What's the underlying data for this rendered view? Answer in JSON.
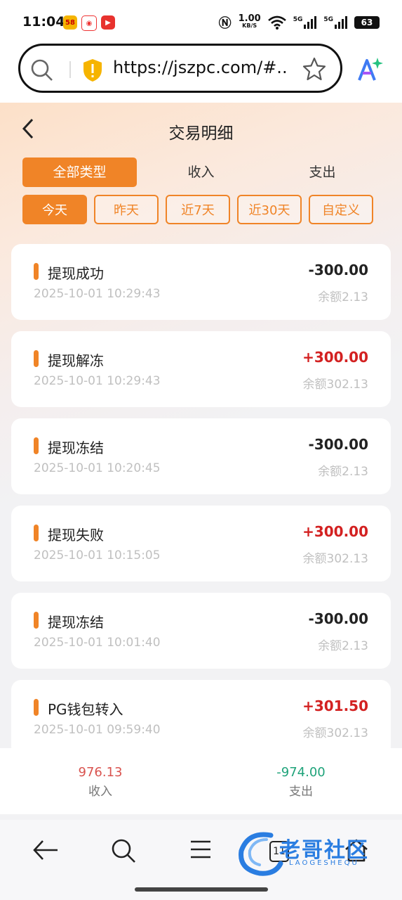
{
  "status": {
    "time": "11:04",
    "net_speed": "1.00",
    "net_unit": "KB/S",
    "sig1": "5G",
    "sig2": "5G",
    "battery": "63"
  },
  "browser": {
    "url": "https://jszpc.com/#..."
  },
  "page": {
    "title": "交易明细",
    "tabs": [
      "全部类型",
      "收入",
      "支出"
    ],
    "filters": [
      "今天",
      "昨天",
      "近7天",
      "近30天",
      "自定义"
    ],
    "transactions": [
      {
        "name": "提现成功",
        "amount": "-300.00",
        "date": "2025-10-01 10:29:43",
        "balance": "余额2.13"
      },
      {
        "name": "提现解冻",
        "amount": "+300.00",
        "date": "2025-10-01 10:29:43",
        "balance": "余额302.13"
      },
      {
        "name": "提现冻结",
        "amount": "-300.00",
        "date": "2025-10-01 10:20:45",
        "balance": "余额2.13"
      },
      {
        "name": "提现失败",
        "amount": "+300.00",
        "date": "2025-10-01 10:15:05",
        "balance": "余额302.13"
      },
      {
        "name": "提现冻结",
        "amount": "-300.00",
        "date": "2025-10-01 10:01:40",
        "balance": "余额2.13"
      },
      {
        "name": "PG钱包转入",
        "amount": "+301.50",
        "date": "2025-10-01 09:59:40",
        "balance": "余额302.13"
      }
    ]
  },
  "summary": {
    "income_value": "976.13",
    "income_label": "收入",
    "expense_value": "-974.00",
    "expense_label": "支出"
  },
  "nav": {
    "tab_count": "11"
  },
  "watermark": {
    "text": "老哥社区",
    "sub": "LAOGESHEQU"
  },
  "colors": {
    "accent": "#f08427",
    "positive_amount": "#d32121",
    "income": "#d9534f",
    "expense": "#1fa37a"
  }
}
